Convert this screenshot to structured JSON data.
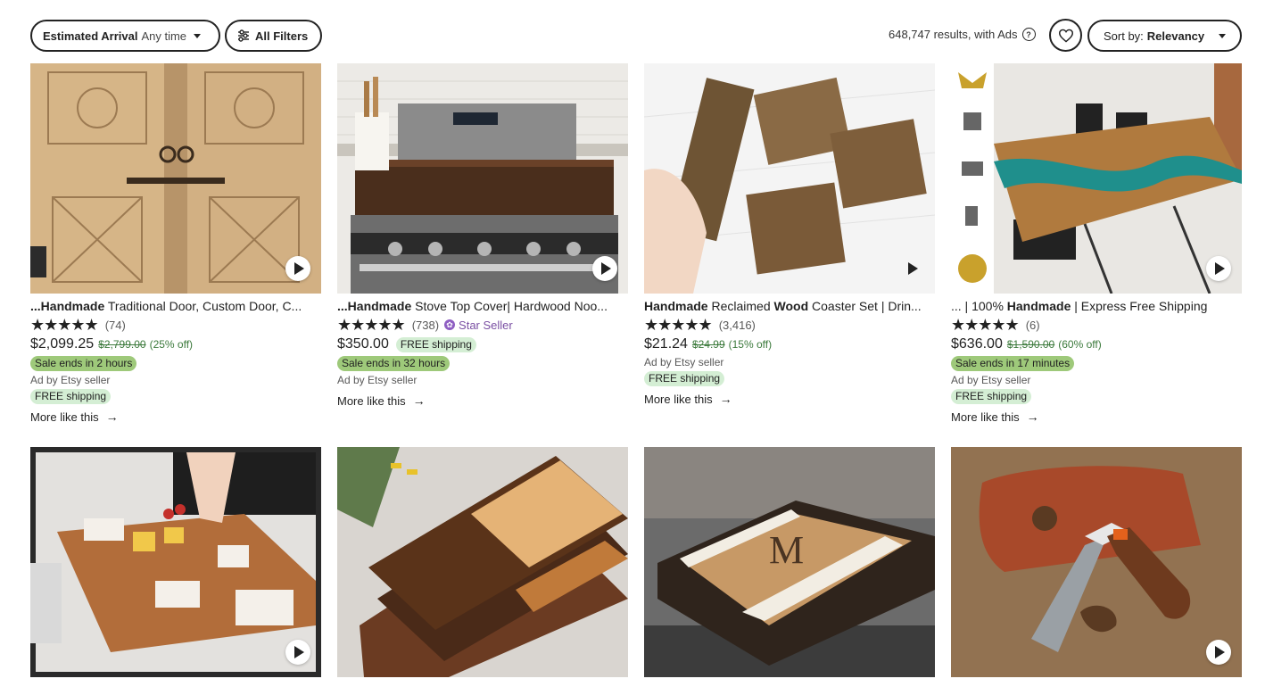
{
  "topbar": {
    "arrival_label": "Estimated Arrival",
    "arrival_value": "Any time",
    "filters_label": "All Filters",
    "results_text": "648,747 results, with Ads",
    "sort_label": "Sort by:",
    "sort_value": "Relevancy"
  },
  "listings": [
    {
      "title_bold": "...Handmade",
      "title_rest": " Traditional Door, Custom Door, C...",
      "stars": "★★★★★",
      "reviews": "(74)",
      "price": "$2,099.25",
      "orig_price": "$2,799.00",
      "discount": "(25% off)",
      "sale": "Sale ends in 2 hours",
      "ad": "Ad by Etsy seller",
      "free": "FREE shipping",
      "more": "More like this"
    },
    {
      "title_bold": "...Handmade",
      "title_rest": " Stove Top Cover| Hardwood Noo...",
      "stars": "★★★★★",
      "reviews": "(738)",
      "star_seller": "Star Seller",
      "price": "$350.00",
      "free": "FREE shipping",
      "sale": "Sale ends in 32 hours",
      "ad": "Ad by Etsy seller",
      "more": "More like this"
    },
    {
      "title_bold": "Handmade",
      "title_mid": " Reclaimed ",
      "title_bold2": "Wood",
      "title_rest": " Coaster Set | Drin...",
      "stars": "★★★★★",
      "reviews": "(3,416)",
      "price": "$21.24",
      "orig_price": "$24.99",
      "discount": "(15% off)",
      "ad": "Ad by Etsy seller",
      "free": "FREE shipping",
      "more": "More like this"
    },
    {
      "title_pre": "... | 100% ",
      "title_bold": "Handmade",
      "title_rest": " | Express Free Shipping",
      "stars": "★★★★★",
      "reviews": "(6)",
      "price": "$636.00",
      "orig_price": "$1,590.00",
      "discount": "(60% off)",
      "sale": "Sale ends in 17 minutes",
      "ad": "Ad by Etsy seller",
      "free": "FREE shipping",
      "more": "More like this"
    }
  ],
  "colors": {
    "sale_badge": "#9ec97a",
    "free_badge": "#d4eed4",
    "discount": "#3c7a3c",
    "star_seller": "#7a4fa3"
  }
}
